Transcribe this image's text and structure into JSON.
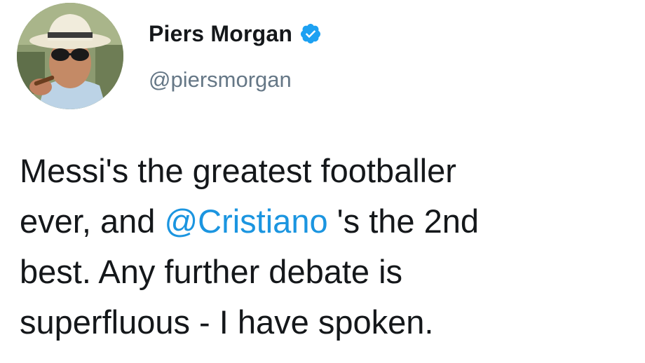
{
  "user": {
    "display_name": "Piers Morgan",
    "handle": "@piersmorgan",
    "verified": true,
    "avatar_icon": "profile-photo"
  },
  "tweet": {
    "line1": "Messi's the greatest footballer",
    "line2_before": "ever, and ",
    "mention": "@Cristiano",
    "line2_after": " 's the 2nd",
    "line3": "best. Any further debate is",
    "line4": "superfluous - I have spoken."
  },
  "colors": {
    "text": "#14171a",
    "secondary": "#657786",
    "link": "#1b95e0",
    "verified_badge": "#1da1f2"
  }
}
